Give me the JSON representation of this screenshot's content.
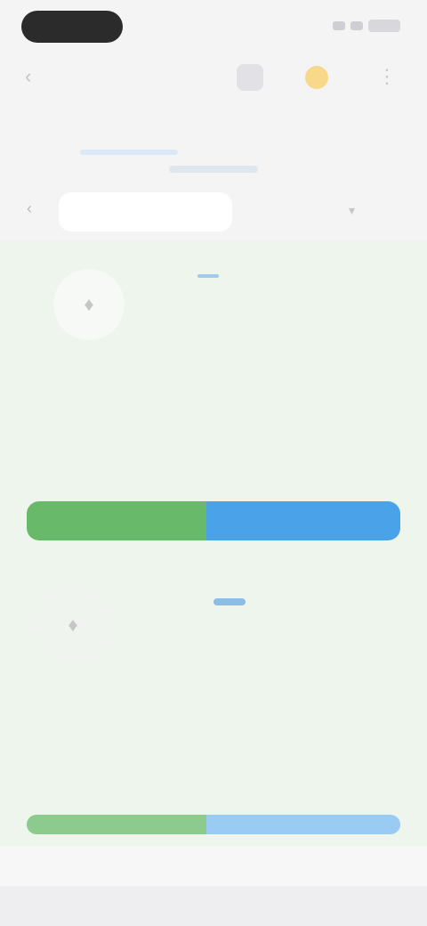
{
  "status_bar": {
    "time": "",
    "battery": ""
  },
  "nav": {
    "back_glyph": "‹",
    "title": "",
    "more_glyph": "⋮",
    "icons": [
      "grid-icon",
      "sun-icon"
    ]
  },
  "tabs": [
    {
      "label": ""
    },
    {
      "label": ""
    }
  ],
  "filter": {
    "left_label": "",
    "right_label": "",
    "caret": "▾",
    "chevron": "‹"
  },
  "records": [
    {
      "avatar_glyph": "♦",
      "name": "",
      "badge": "",
      "subtitle": "",
      "rows": [
        {
          "label": "",
          "value": ""
        },
        {
          "label": "",
          "value": ""
        }
      ],
      "ratio_label": "",
      "ratio_value": "",
      "split_fraction": 0.48
    },
    {
      "avatar_glyph": "♦",
      "name": "",
      "badge": "",
      "subtitle": "",
      "rows": [
        {
          "label": "",
          "value": ""
        },
        {
          "label": "",
          "value": ""
        }
      ],
      "ratio_label": "",
      "ratio_value": "",
      "split_fraction": 0.48
    }
  ],
  "colors": {
    "accent_green": "#69b96b",
    "accent_blue": "#4aa2e8",
    "badge_blue": "#9ecbee",
    "content_bg": "#edf5ec"
  }
}
